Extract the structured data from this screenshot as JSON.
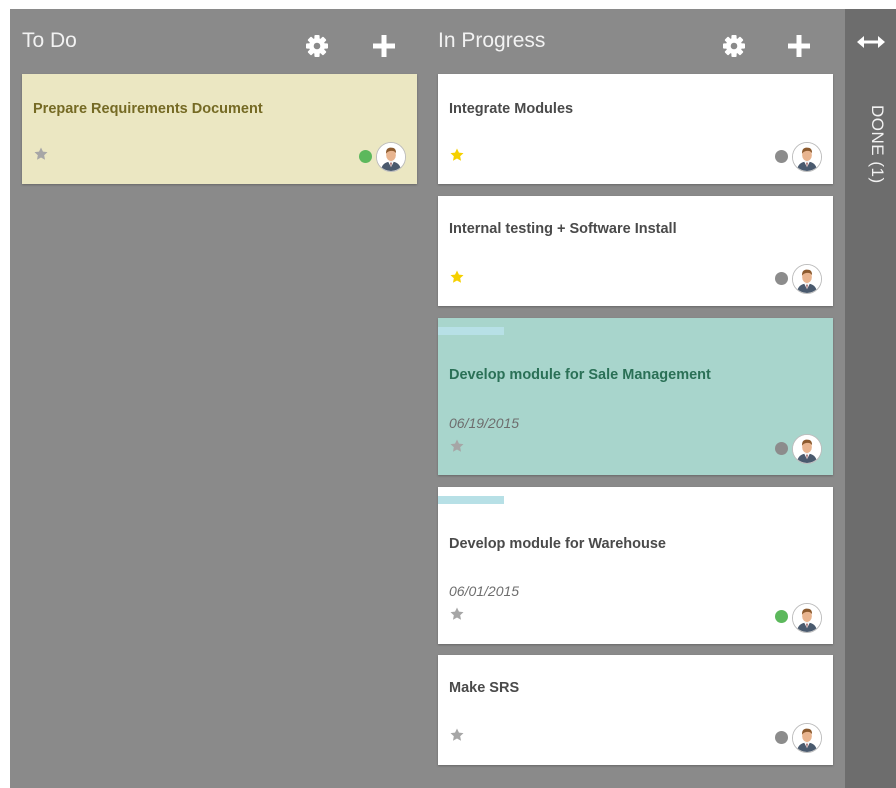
{
  "colors": {
    "board_bg": "#8a8a8a",
    "done_bg": "#6d6d6d",
    "card_yellow": "#ebe7c2",
    "card_teal": "#a8d5cc",
    "star_active": "#f5d000",
    "star_inactive": "#a6a6a6",
    "status_green": "#5cb85c",
    "status_gray": "#8c8c8c"
  },
  "columns": {
    "todo": {
      "title": "To Do",
      "settings_icon": "gear-icon",
      "add_icon": "plus-icon"
    },
    "in_progress": {
      "title": "In Progress",
      "settings_icon": "gear-icon",
      "add_icon": "plus-icon"
    },
    "done": {
      "title": "DONE (1)",
      "expand_icon": "horizontal-arrows-icon"
    }
  },
  "cards": {
    "todo": [
      {
        "title": "Prepare Requirements Document",
        "starred": false,
        "status": "green",
        "color": "yellow"
      }
    ],
    "in_progress": [
      {
        "title": "Integrate Modules",
        "starred": true,
        "status": "gray"
      },
      {
        "title": "Internal testing + Software Install",
        "starred": true,
        "status": "gray"
      },
      {
        "title": "Develop module for Sale Management",
        "date": "06/19/2015",
        "starred": false,
        "status": "gray",
        "color": "teal"
      },
      {
        "title": "Develop module for Warehouse",
        "date": "06/01/2015",
        "starred": false,
        "status": "green"
      },
      {
        "title": "Make SRS",
        "starred": false,
        "status": "gray"
      }
    ]
  }
}
